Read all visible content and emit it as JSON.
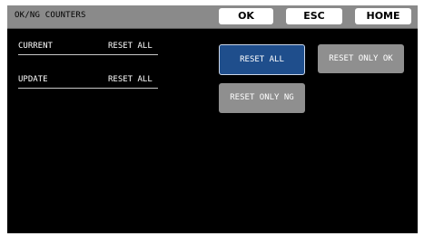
{
  "header": {
    "title": "OK/NG COUNTERS",
    "buttons": {
      "ok": "OK",
      "esc": "ESC",
      "home": "HOME"
    }
  },
  "counters": {
    "rows": [
      {
        "label": "CURRENT",
        "value": "RESET ALL"
      },
      {
        "label": "UPDATE",
        "value": "RESET ALL"
      }
    ]
  },
  "actions": {
    "reset_all": "RESET ALL",
    "reset_only_ok": "RESET ONLY OK",
    "reset_only_ng": "RESET ONLY NG",
    "selected": "reset_all"
  },
  "colors": {
    "screen_background": "#000000",
    "title_bar": "#8a8a8a",
    "button_default": "#8f8f8f",
    "button_selected": "#1f4e8c",
    "header_button": "#ffffff"
  }
}
